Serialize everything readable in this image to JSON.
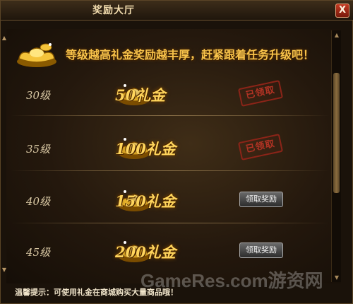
{
  "window": {
    "title": "奖励大厅",
    "close_glyph": "X"
  },
  "banner": {
    "text": "等级越高礼金奖励越丰厚，赶紧跟着任务升级吧！"
  },
  "rows": [
    {
      "level": "30级",
      "gift": "50礼金",
      "status": "已领取"
    },
    {
      "level": "35级",
      "gift": "100礼金",
      "status": "已领取"
    },
    {
      "level": "40级",
      "gift": "150礼金",
      "button": "领取奖励"
    },
    {
      "level": "45级",
      "gift": "200礼金",
      "button": "领取奖励"
    }
  ],
  "tip": "温馨提示：可使用礼金在商城购买大量商品哦！",
  "watermark": "GameRes.com游资网",
  "colors": {
    "gold": "#ffd55c",
    "banner": "#f7c24a",
    "stamp": "#b13324"
  }
}
